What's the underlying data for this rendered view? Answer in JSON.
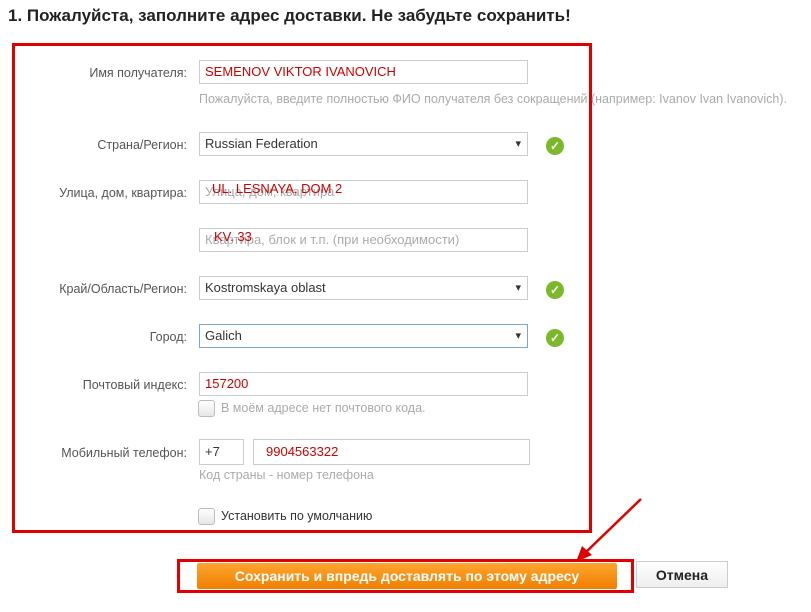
{
  "title": "1. Пожалуйста, заполните адрес доставки. Не забудьте сохранить!",
  "form": {
    "name": {
      "label": "Имя получателя:",
      "value": "SEMENOV VIKTOR IVANOVICH",
      "hint": "Пожалуйста, введите полностью ФИО получателя без сокращений (например: Ivanov Ivan Ivanovich)."
    },
    "country": {
      "label": "Страна/Регион:",
      "value": "Russian Federation"
    },
    "street": {
      "label": "Улица, дом, квартира:",
      "placeholder": "Улица, дом, квартира",
      "value": "UL. LESNAYA, DOM 2"
    },
    "apartment": {
      "placeholder": "Квартира, блок и т.п. (при необходимости)",
      "value": "KV. 33"
    },
    "region": {
      "label": "Край/Область/Регион:",
      "value": "Kostromskaya oblast"
    },
    "city": {
      "label": "Город:",
      "value": "Galich"
    },
    "postal": {
      "label": "Почтовый индекс:",
      "value": "157200",
      "no_code_label": "В моём адресе нет почтового кода.",
      "no_code_checked": false
    },
    "phone": {
      "label": "Мобильный телефон:",
      "country_code": "+7",
      "number": "9904563322",
      "hint": "Код страны - номер телефона"
    },
    "default": {
      "label": "Установить по умолчанию",
      "checked": false
    }
  },
  "buttons": {
    "save": "Сохранить и впредь доставлять по этому адресу",
    "cancel": "Отмена"
  },
  "colors": {
    "annotation": "#e00000",
    "save_button": "#f79a1a",
    "valid_check": "#7cb92a"
  },
  "icons": {
    "valid": "check-circle-icon",
    "dropdown": "triangle-down-icon"
  }
}
